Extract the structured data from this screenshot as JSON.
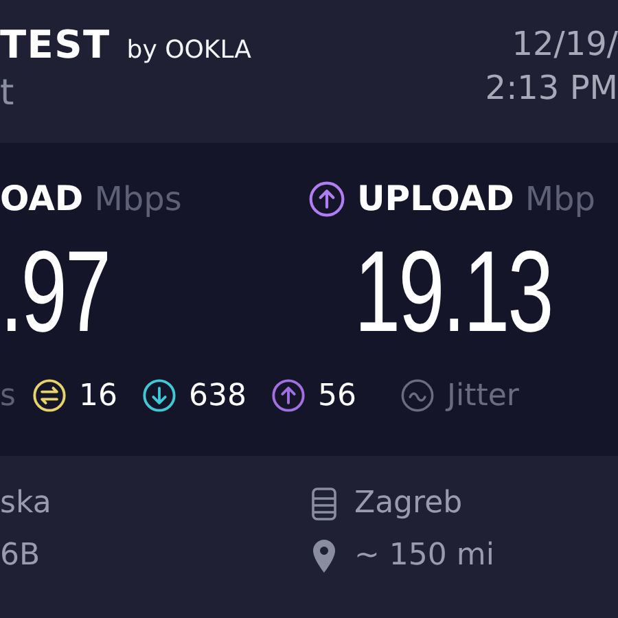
{
  "header": {
    "brand": "TEST",
    "brand_suffix": "by OOKLA",
    "subtitle": "t",
    "date": "12/19/",
    "time": "2:13 PM"
  },
  "results": [
    {
      "kind": "download",
      "label": "OAD",
      "unit": "Mbps",
      "value": ".97"
    },
    {
      "kind": "upload",
      "label": "UPLOAD",
      "unit": "Mbp",
      "value": "19.13"
    }
  ],
  "ping": {
    "unit_tail": "s",
    "stats": [
      {
        "kind": "idle",
        "value": "16",
        "color": "#e6d36a"
      },
      {
        "kind": "down",
        "value": "638",
        "color": "#3fc9d4"
      },
      {
        "kind": "up",
        "value": "56",
        "color": "#a070e0"
      }
    ],
    "jitter_label": "Jitter"
  },
  "details": {
    "left": [
      "ska",
      "6B"
    ],
    "server": "Zagreb",
    "distance": "~ 150 mi"
  }
}
